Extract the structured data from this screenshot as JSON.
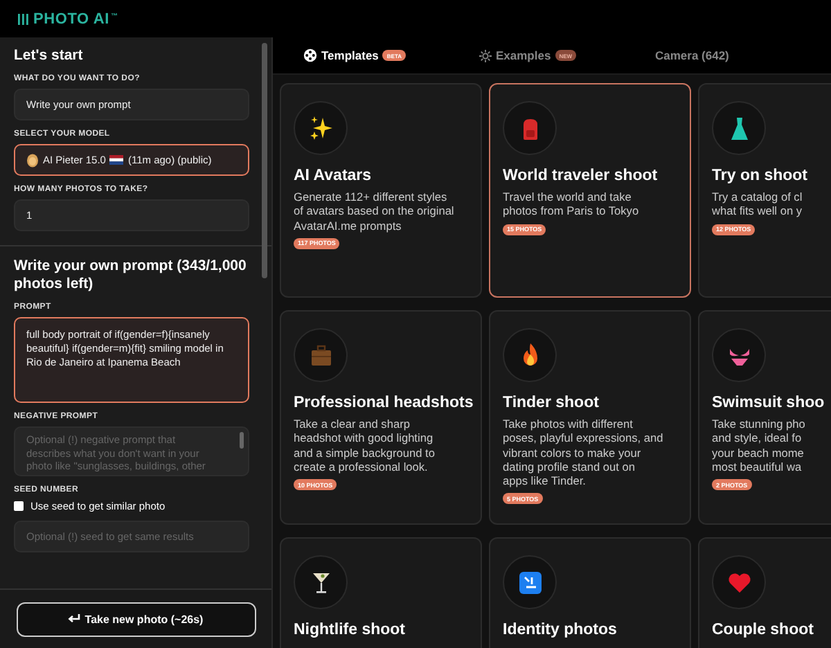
{
  "logo": {
    "text": "PHOTO AI",
    "mark": "™"
  },
  "sidebar": {
    "title": "Let's start",
    "fields": [
      {
        "kind": "input",
        "label": "WHAT DO YOU WANT TO DO?",
        "value": "Write your own prompt",
        "focused": false
      },
      {
        "kind": "model",
        "label": "SELECT YOUR MODEL",
        "value": "AI Pieter 15.0",
        "suffix": "(11m ago) (public)",
        "focused": true
      },
      {
        "kind": "input",
        "label": "HOW MANY PHOTOS TO TAKE?",
        "value": "1",
        "focused": false
      }
    ],
    "prompt_section": {
      "title": "Write your own prompt (343/1,000 photos left)",
      "prompt": {
        "label": "PROMPT",
        "value": "full body portrait of if(gender=f){insanely beautiful} if(gender=m){fit} smiling model in Rio de Janeiro at Ipanema Beach",
        "focused": true
      },
      "negative": {
        "label": "NEGATIVE PROMPT",
        "placeholder": "Optional (!) negative prompt that describes what you don't want in your photo like \"sunglasses, buildings, other"
      },
      "seed": {
        "label": "SEED NUMBER",
        "checkbox": "Use seed to get similar photo",
        "checked": false,
        "placeholder": "Optional (!) seed to get same results"
      }
    },
    "button": "Take new photo (~26s)"
  },
  "tabs": [
    {
      "label": "Templates",
      "badge": "BETA",
      "selected": true
    },
    {
      "label": "Examples",
      "badge": "NEW",
      "selected": false
    },
    {
      "label": "Camera (642)",
      "selected": false
    }
  ],
  "cards": [
    {
      "title": "AI Avatars",
      "description": "Generate 112+ different styles\nof avatars based on the original\nAvatarAI.me prompts",
      "badge": "117 PHOTOS",
      "selected": false
    },
    {
      "title": "World traveler shoot",
      "description": "Travel the world and take\nphotos from Paris to Tokyo",
      "badge": "15 PHOTOS",
      "selected": true
    },
    {
      "title": "Try on shoot",
      "description": "Try a catalog of cl\nwhat fits well on y",
      "badge": "12 PHOTOS",
      "selected": false
    },
    {
      "title": "Professional headshots",
      "description": "Take a clear and sharp\nheadshot with good lighting\nand a simple background to\ncreate a professional look.",
      "badge": "10 PHOTOS",
      "selected": false
    },
    {
      "title": "Tinder shoot",
      "description": "Take photos with different\nposes, playful expressions, and\nvibrant colors to make your\ndating profile stand out on\napps like Tinder.",
      "badge": "5 PHOTOS",
      "selected": false
    },
    {
      "title": "Swimsuit shoo",
      "description": "Take stunning pho\nand style, ideal fo\nyour beach mome\nmost beautiful wa",
      "badge": "2 PHOTOS",
      "selected": false
    },
    {
      "title": "Nightlife shoot",
      "selected": false
    },
    {
      "title": "Identity photos",
      "selected": false
    },
    {
      "title": "Couple shoot",
      "selected": false
    }
  ]
}
